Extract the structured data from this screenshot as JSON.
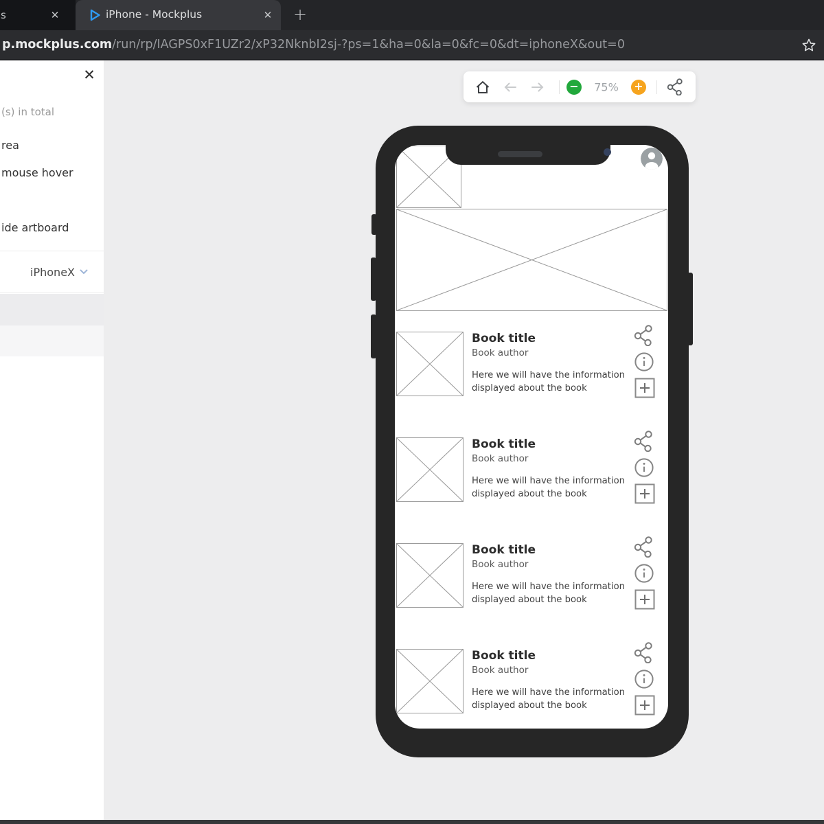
{
  "browser": {
    "partial_tab_fragment": "s",
    "active_tab_title": "iPhone - Mockplus",
    "url_domain": "p.mockplus.com",
    "url_path": "/run/rp/IAGPS0xF1UZr2/xP32NknbI2sj-?ps=1&ha=0&la=0&fc=0&dt=iphoneX&out=0"
  },
  "icons": {
    "close": "✕",
    "new_tab": "+",
    "zoom_out_glyph": "−",
    "zoom_in_glyph": "+"
  },
  "panel": {
    "total_fragment": "(s) in total",
    "option_fragments": [
      "rea",
      "mouse hover",
      "ide artboard"
    ],
    "device": "iPhoneX"
  },
  "toolbar": {
    "zoom_level": "75%"
  },
  "phone": {
    "books": [
      {
        "title": "Book title",
        "author": "Book author",
        "description": "Here we will have the information displayed about the book"
      },
      {
        "title": "Book title",
        "author": "Book author",
        "description": "Here we will have the information displayed about the book"
      },
      {
        "title": "Book title",
        "author": "Book author",
        "description": "Here we will have the information displayed about the book"
      },
      {
        "title": "Book title",
        "author": "Book author",
        "description": "Here we will have the information displayed about the book"
      }
    ]
  },
  "colors": {
    "zoom_out_green": "#22a83c",
    "zoom_in_orange": "#f6a41e",
    "play_icon_blue": "#2f9bf4",
    "phone_frame": "#262626",
    "canvas_gray": "#ededee"
  }
}
